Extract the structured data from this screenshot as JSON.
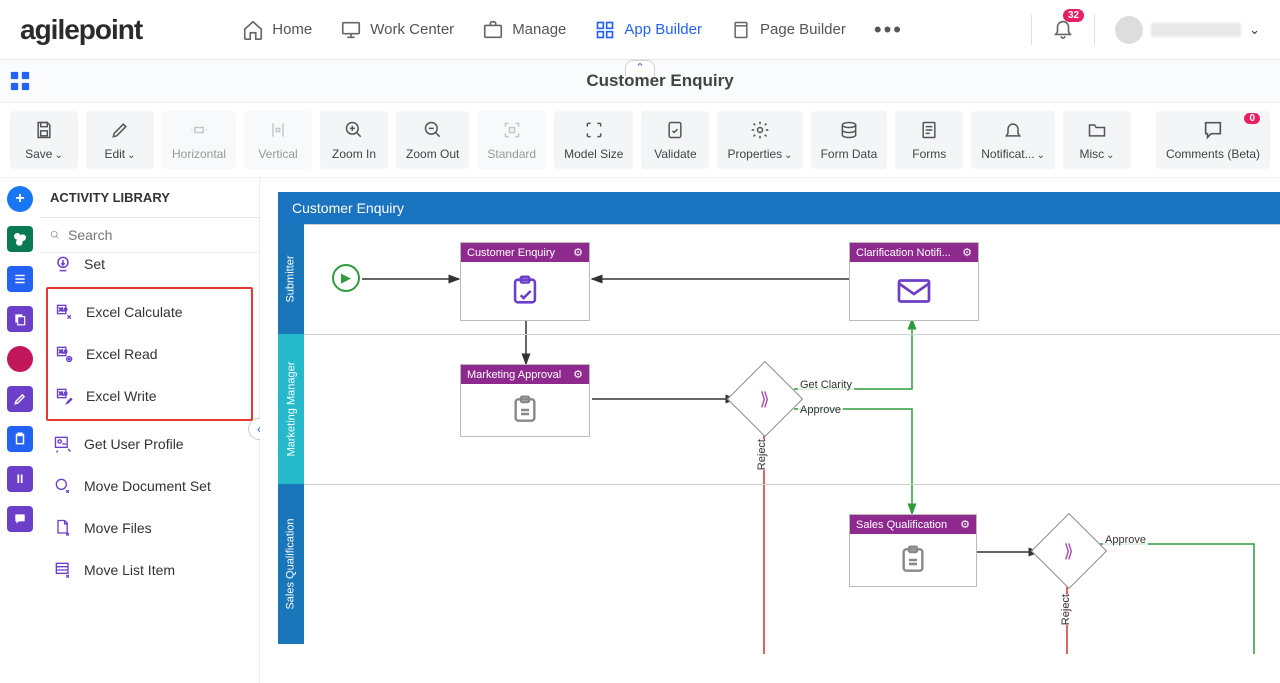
{
  "nav": {
    "logo": "agilepoint",
    "items": [
      {
        "label": "Home"
      },
      {
        "label": "Work Center"
      },
      {
        "label": "Manage"
      },
      {
        "label": "App Builder"
      },
      {
        "label": "Page Builder"
      }
    ],
    "notificationCount": "32"
  },
  "pageTitle": "Customer Enquiry",
  "toolbar": {
    "save": "Save",
    "edit": "Edit",
    "horizontal": "Horizontal",
    "vertical": "Vertical",
    "zoomIn": "Zoom In",
    "zoomOut": "Zoom Out",
    "standard": "Standard",
    "modelSize": "Model Size",
    "validate": "Validate",
    "properties": "Properties",
    "formData": "Form Data",
    "forms": "Forms",
    "notifications": "Notificat...",
    "misc": "Misc",
    "comments": "Comments (Beta)",
    "commentsCount": "0"
  },
  "activity": {
    "header": "ACTIVITY LIBRARY",
    "searchPlaceholder": "Search",
    "items": {
      "downloadDocSet": "Set",
      "excelCalculate": "Excel Calculate",
      "excelRead": "Excel Read",
      "excelWrite": "Excel Write",
      "getUserProfile": "Get User Profile",
      "moveDocumentSet": "Move Document Set",
      "moveFiles": "Move Files",
      "moveListItem": "Move List Item"
    }
  },
  "canvas": {
    "processName": "Customer Enquiry",
    "lanes": {
      "submitter": "Submitter",
      "marketing": "Marketing Manager",
      "sales": "Sales Qualification"
    },
    "nodes": {
      "customerEnquiry": "Customer Enquiry",
      "clarificationNotif": "Clarification Notifi...",
      "marketingApproval": "Marketing Approval",
      "salesQualification": "Sales Qualification"
    },
    "edges": {
      "getClarity": "Get Clarity",
      "approve1": "Approve",
      "reject1": "Reject",
      "approve2": "Approve",
      "reject2": "Reject"
    }
  }
}
